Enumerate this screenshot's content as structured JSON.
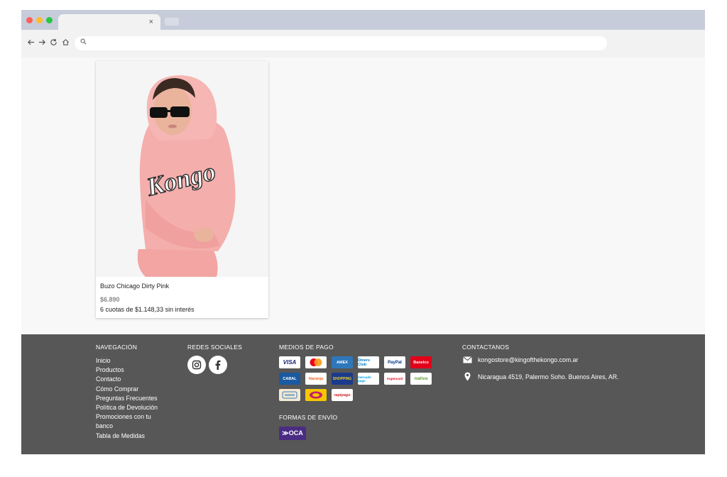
{
  "browser": {
    "tab_close": "×",
    "icons": [
      "back-arrow-icon",
      "forward-arrow-icon",
      "reload-icon",
      "home-icon",
      "search-icon"
    ],
    "dot_colors": [
      "#ff5f57",
      "#febc2e",
      "#28c840"
    ]
  },
  "product": {
    "name": "Buzo Chicago Dirty Pink",
    "price": "$6.890",
    "installments": "6 cuotas de $1.148,33 sin interés",
    "image_print": "Kongo"
  },
  "footer": {
    "navigation": {
      "heading": "NAVEGACIÓN",
      "links": [
        "Inicio",
        "Productos",
        "Contacto",
        "Cómo Comprar",
        "Preguntas Frecuentes",
        "Política de Devolución",
        "Promociones con tu",
        "banco",
        "Tabla de Medidas"
      ]
    },
    "social": {
      "heading": "REDES SOCIALES",
      "items": [
        {
          "icon": "instagram-icon"
        },
        {
          "icon": "facebook-icon"
        }
      ]
    },
    "payment": {
      "heading": "MEDIOS DE PAGO",
      "methods": [
        {
          "label": "VISA",
          "bg": "#ffffff",
          "fg": "#1a1f71"
        },
        {
          "label": "",
          "bg": "#ffffff",
          "fg": "#eb001b"
        },
        {
          "label": "AMEX",
          "bg": "#2e77bb",
          "fg": "#ffffff"
        },
        {
          "label": "Diners Club",
          "bg": "#ffffff",
          "fg": "#0079be"
        },
        {
          "label": "PayPal",
          "bg": "#ffffff",
          "fg": "#003087"
        },
        {
          "label": "Banelco",
          "bg": "#e2001a",
          "fg": "#ffffff"
        },
        {
          "label": "CABAL",
          "bg": "#1a5aa0",
          "fg": "#ffffff"
        },
        {
          "label": "Naranja",
          "bg": "#ffffff",
          "fg": "#f26522"
        },
        {
          "label": "SHOPPING",
          "bg": "#1b3a8c",
          "fg": "#f7d117"
        },
        {
          "label": "mercado pago",
          "bg": "#ffffff",
          "fg": "#009ee3"
        },
        {
          "label": "Argencard",
          "bg": "#ffffff",
          "fg": "#e2001a"
        },
        {
          "label": "nativa",
          "bg": "#ffffff",
          "fg": "#6a9a3a"
        },
        {
          "label": "",
          "bg": "#f3ead6",
          "fg": "#3a7ab8"
        },
        {
          "label": "",
          "bg": "#f7c600",
          "fg": "#c21f6a"
        },
        {
          "label": "rapipago",
          "bg": "#ffffff",
          "fg": "#d8232a"
        }
      ]
    },
    "shipping": {
      "heading": "FORMAS DE ENVÍO",
      "methods": [
        {
          "label": "≫OCA",
          "bg": "#4b2c83",
          "fg": "#ffffff"
        }
      ]
    },
    "contact": {
      "heading": "CONTACTANOS",
      "email": "kongostore@kingofthekongo.com.ar",
      "address": "Nicaragua 4519, Palermo Soho. Buenos Aires, AR.",
      "icons": [
        "mail-icon",
        "location-pin-icon"
      ]
    }
  }
}
